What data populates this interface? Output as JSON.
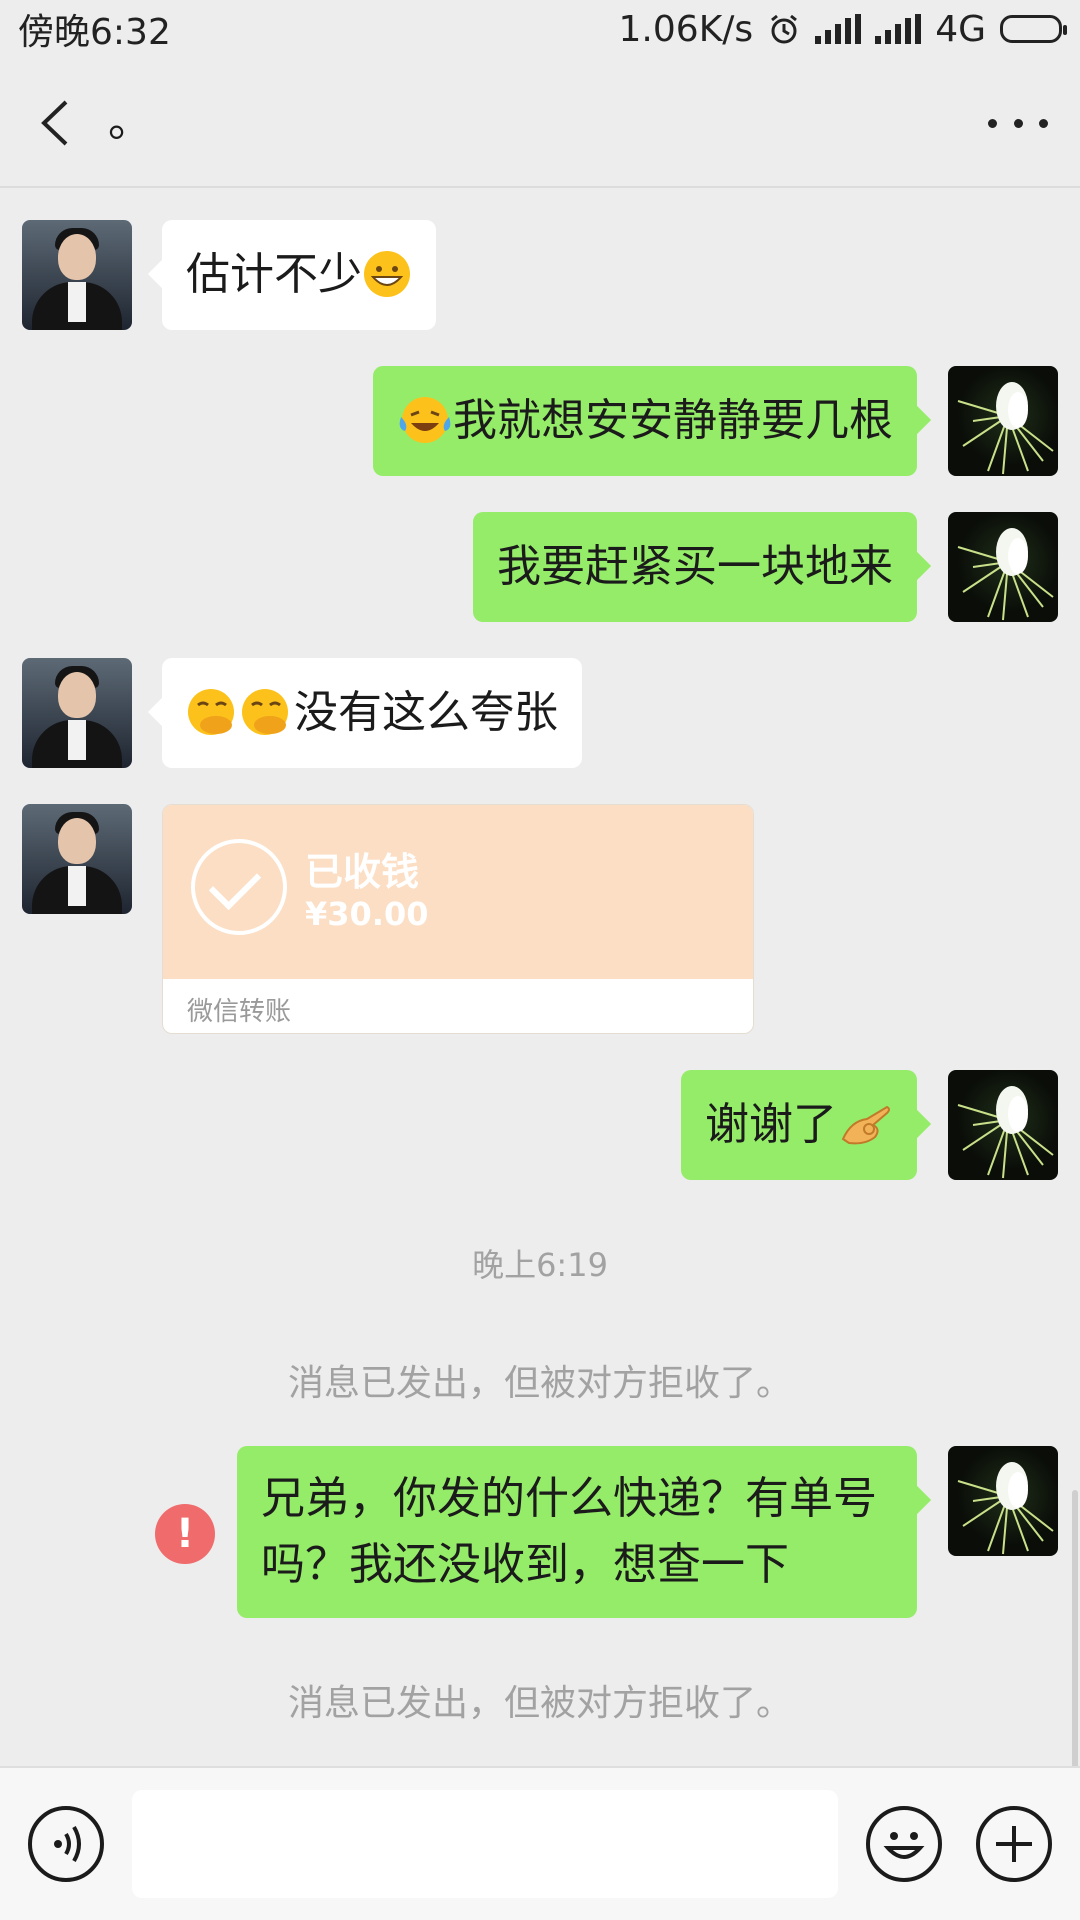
{
  "status_bar": {
    "time": "傍晚6:32",
    "speed": "1.06K/s",
    "network": "4G",
    "icons": [
      "alarm-icon",
      "signal-icon",
      "hd-signal-icon",
      "battery-icon"
    ]
  },
  "nav": {
    "title": "。",
    "icons": [
      "back-icon",
      "more-icon"
    ]
  },
  "messages": [
    {
      "side": "left",
      "text": "估计不少",
      "emoji": [
        "grinning-emoji"
      ]
    },
    {
      "side": "right",
      "text": "我就想安安静静要几根",
      "emoji": [
        "laughing-crying-emoji"
      ]
    },
    {
      "side": "right",
      "text": "我要赶紧买一块地来"
    },
    {
      "side": "left",
      "text": "没有这么夸张",
      "emoji": [
        "hand-over-mouth-emoji",
        "hand-over-mouth-emoji"
      ]
    },
    {
      "side": "left",
      "type": "transfer"
    },
    {
      "side": "right",
      "text": "谢谢了",
      "emoji": [
        "ok-hand-emoji"
      ]
    },
    {
      "side": "right",
      "text": "兄弟，你发的什么快递？有单号吗？我还没收到，想查一下",
      "status": "failed"
    }
  ],
  "transfer": {
    "title": "已收钱",
    "amount": "¥30.00",
    "footer": "微信转账"
  },
  "time_label": "晚上6:19",
  "system_note_1": "消息已发出，但被对方拒收了。",
  "system_note_2": "消息已发出，但被对方拒收了。",
  "error_mark": "!",
  "input_bar": {
    "placeholder": "",
    "icons": [
      "voice-icon",
      "emoji-icon",
      "plus-icon"
    ]
  },
  "colors": {
    "bubble_out": "#95ec69",
    "bubble_in": "#ffffff",
    "transfer_bg": "#fbdec4",
    "error": "#f06b6b",
    "background": "#ededed"
  }
}
